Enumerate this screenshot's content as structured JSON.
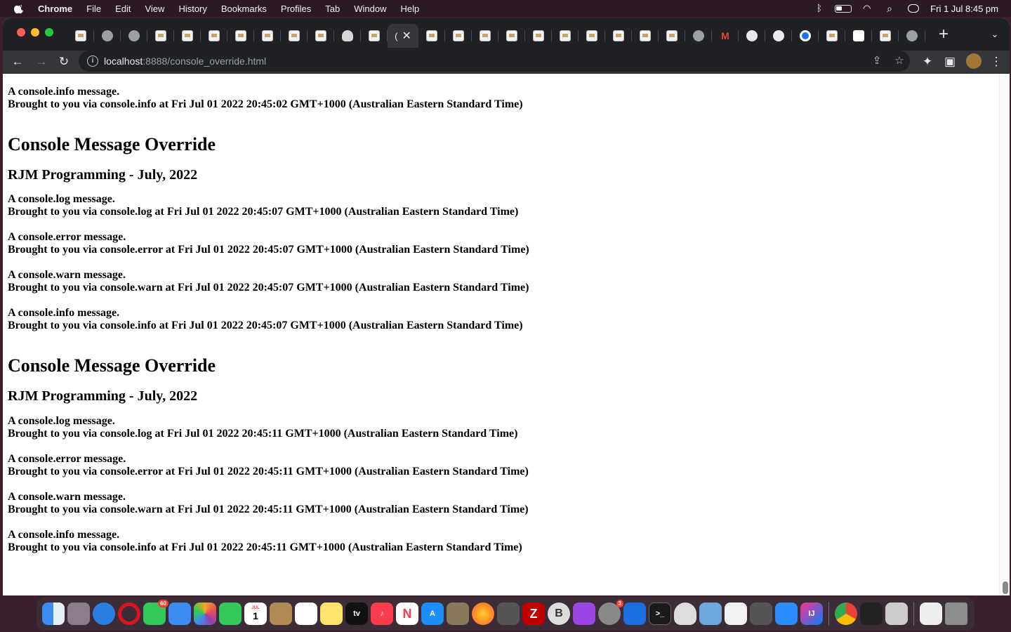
{
  "menubar": {
    "app_name": "Chrome",
    "items": [
      "File",
      "Edit",
      "View",
      "History",
      "Bookmarks",
      "Profiles",
      "Tab",
      "Window",
      "Help"
    ],
    "clock": "Fri 1 Jul  8:45 pm"
  },
  "browser": {
    "active_tab_label": "(",
    "url_host": "localhost",
    "url_path": ":8888/console_override.html"
  },
  "page": {
    "partial_top": {
      "line1": "A console.info message.",
      "line2": "Brought to you via console.info at Fri Jul 01 2022 20:45:02 GMT+1000 (Australian Eastern Standard Time)"
    },
    "sections": [
      {
        "title": "Console Message Override",
        "subtitle": "RJM Programming - July, 2022",
        "messages": [
          {
            "line1": "A console.log message.",
            "line2": "Brought to you via console.log at Fri Jul 01 2022 20:45:07 GMT+1000 (Australian Eastern Standard Time)"
          },
          {
            "line1": "A console.error message.",
            "line2": "Brought to you via console.error at Fri Jul 01 2022 20:45:07 GMT+1000 (Australian Eastern Standard Time)"
          },
          {
            "line1": "A console.warn message.",
            "line2": "Brought to you via console.warn at Fri Jul 01 2022 20:45:07 GMT+1000 (Australian Eastern Standard Time)"
          },
          {
            "line1": "A console.info message.",
            "line2": "Brought to you via console.info at Fri Jul 01 2022 20:45:07 GMT+1000 (Australian Eastern Standard Time)"
          }
        ]
      },
      {
        "title": "Console Message Override",
        "subtitle": "RJM Programming - July, 2022",
        "messages": [
          {
            "line1": "A console.log message.",
            "line2": "Brought to you via console.log at Fri Jul 01 2022 20:45:11 GMT+1000 (Australian Eastern Standard Time)"
          },
          {
            "line1": "A console.error message.",
            "line2": "Brought to you via console.error at Fri Jul 01 2022 20:45:11 GMT+1000 (Australian Eastern Standard Time)"
          },
          {
            "line1": "A console.warn message.",
            "line2": "Brought to you via console.warn at Fri Jul 01 2022 20:45:11 GMT+1000 (Australian Eastern Standard Time)"
          },
          {
            "line1": "A console.info message.",
            "line2": "Brought to you via console.info at Fri Jul 01 2022 20:45:11 GMT+1000 (Australian Eastern Standard Time)"
          }
        ]
      }
    ]
  },
  "dock": {
    "calendar_month": "JUL",
    "calendar_day": "1",
    "messages_badge": "60",
    "settings_badge": "3"
  }
}
